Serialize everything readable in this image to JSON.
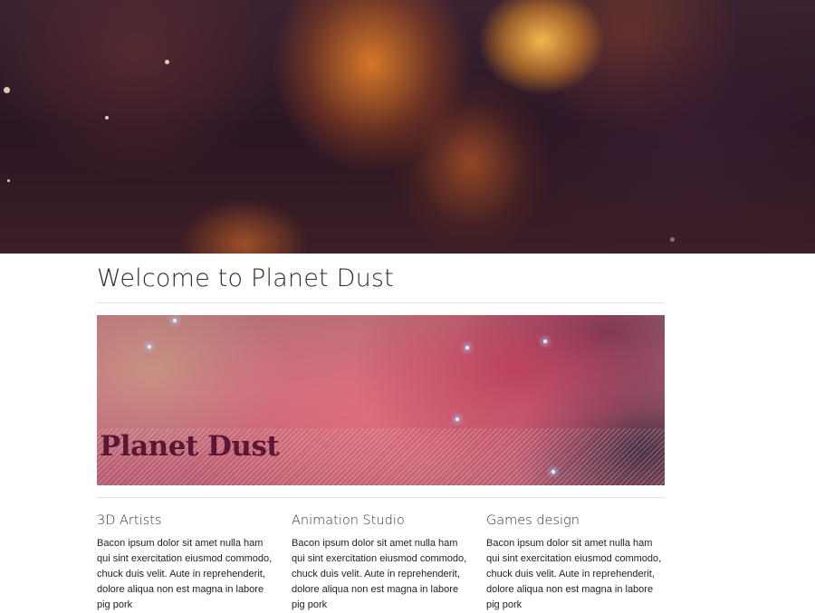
{
  "page": {
    "title": "Welcome to Planet Dust"
  },
  "banner": {
    "title": "Planet Dust"
  },
  "columns": [
    {
      "heading": "3D Artists",
      "text": "Bacon ipsum dolor sit amet nulla ham qui sint exercitation eiusmod commodo, chuck duis velit. Aute in reprehenderit, dolore aliqua non est magna in labore pig pork"
    },
    {
      "heading": "Animation Studio",
      "text": "Bacon ipsum dolor sit amet nulla ham qui sint exercitation eiusmod commodo, chuck duis velit. Aute in reprehenderit, dolore aliqua non est magna in labore pig pork"
    },
    {
      "heading": "Games design",
      "text": "Bacon ipsum dolor sit amet nulla ham qui sint exercitation eiusmod commodo, chuck duis velit. Aute in reprehenderit, dolore aliqua non est magna in labore pig pork"
    }
  ],
  "colors": {
    "banner_title": "#5a1733",
    "heading_text": "#2d2d2d",
    "divider": "#e2e2e2"
  }
}
